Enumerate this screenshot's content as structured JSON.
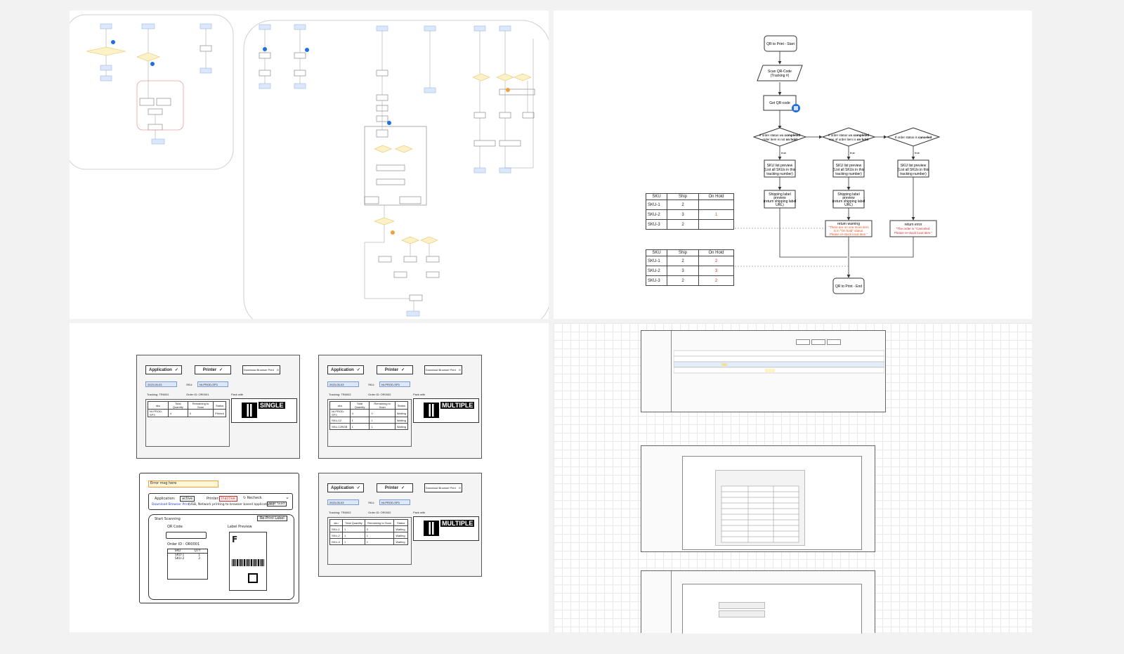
{
  "flowchart": {
    "nodes": {
      "start": "QR to Print - Start",
      "scan": "Scan QR-Code\n(Tracking #)",
      "get_qr": "Get QR-code",
      "cond1": "If order status wa completed\norder item is not on hold",
      "cond2": "If order status wa completed\none of order item is on hold",
      "cond3": "If order status is canceled",
      "true1": "true",
      "true2": "true",
      "true3": "true",
      "sku1": "SKU list preview\n(List all SKUs in this\ntracking number)",
      "sku2": "SKU list preview\n(List all SKUs in this\ntracking number)",
      "sku3": "SKU list preview\n(List all SKUs in this\ntracking number)",
      "ship1": "Shipping label\npreview\n(return shipping label\nURL)",
      "ship2": "Shipping label\npreview\n(return shipping label\nURL)",
      "warn_title": "return warning",
      "warn_msg": "\"There are on one more item\nis in \"On hold\" status.\nPlease re-stock local item.\"",
      "err_title": "return error",
      "err_msg": "\"The order is \"Canceled.\nPlease re-stock local item.\"",
      "end": "QR to Print - End"
    },
    "table1": {
      "headers": [
        "SKU",
        "Ship",
        "On Hold"
      ],
      "rows": [
        [
          "SKU-1",
          "2",
          ""
        ],
        [
          "SKU-2",
          "3",
          "1"
        ],
        [
          "SKU-3",
          "2",
          ""
        ]
      ]
    },
    "table2": {
      "headers": [
        "SKU",
        "Ship",
        "On Hold"
      ],
      "rows": [
        [
          "SKU-1",
          "2",
          "2"
        ],
        [
          "SKU-2",
          "3",
          "3"
        ],
        [
          "SKU-3",
          "2",
          "2"
        ]
      ]
    },
    "colors": {
      "highlight": "#e8511c",
      "warn_text": "#e8511c",
      "err_text": "#d62828"
    }
  },
  "mockups": {
    "application_label": "Application",
    "printer_label": "Printer",
    "download_label": "Download Browser Print",
    "sku_label": "SKU:",
    "pack_with": "Pack with",
    "headers": [
      "sku",
      "Total Quantity",
      "Remaining to Scan",
      "Status"
    ],
    "single": {
      "input": "2023-05-03",
      "sku": "NI-PROD-SP3",
      "tracking": "Tracking: TR6001",
      "order": "Order ID: OR0001",
      "rows": [
        [
          "NI-PROD-SP3",
          "4",
          "0",
          "Printed"
        ]
      ],
      "tag": "SINGLE"
    },
    "multiple1": {
      "input": "2023-05-03",
      "sku": "NI-PROD-SP3",
      "tracking": "Tracking: TR6002",
      "order": "Order ID: OR0002",
      "rows": [
        [
          "NI-PROD-SP3",
          "4",
          "0",
          "Waiting"
        ],
        [
          "SKU-12",
          "1",
          "1",
          "Waiting"
        ],
        [
          "SKU-12BGB",
          "1",
          "1",
          "Waiting"
        ]
      ],
      "tag": "MULTIPLE"
    },
    "multiple2": {
      "input": "2023-05-03",
      "sku": "NI-PROD-SP3",
      "tracking": "Tracking: TR6002",
      "order": "Order ID: OR0002",
      "rows": [
        [
          "SKU-1",
          "1",
          "0",
          "Waiting"
        ],
        [
          "SKU-2",
          "1",
          "1",
          "Waiting"
        ],
        [
          "SKU-3",
          "1",
          "1",
          "Waiting"
        ]
      ],
      "tag": "MULTIPLE"
    },
    "sketch": {
      "error": "Error msg here",
      "application": "Application:",
      "application_val": "active",
      "printer": "Printer:",
      "printer_val": "inactive",
      "recheck": "Recheck",
      "download_link": "Download Browser Print",
      "download_desc": "(USB, Network printing to browser based applications)",
      "user_guide": "User Guid",
      "start_scanning": "Start Scanning",
      "reprint": "Re-Print Label",
      "qr_code": "QR Code",
      "label_preview": "Label Preview",
      "order_id": "Order ID :",
      "order_val": "OR0001",
      "sku_col": "SKU",
      "qty_col": "QTY",
      "rows": [
        [
          "SKU-1",
          "1"
        ],
        [
          "SKU-2",
          "2"
        ]
      ]
    }
  }
}
